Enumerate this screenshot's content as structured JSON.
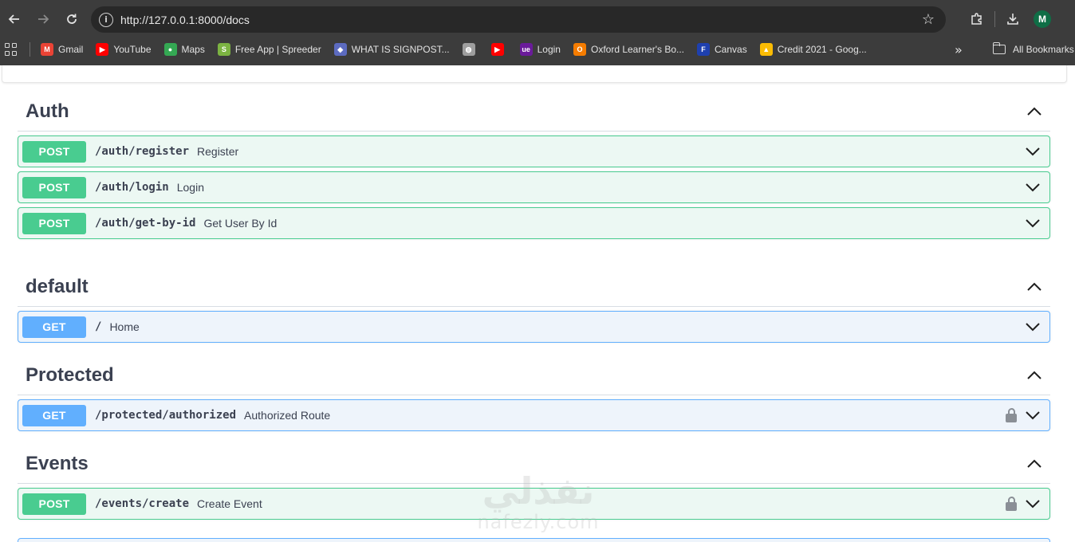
{
  "browser": {
    "url": "http://127.0.0.1:8000/docs",
    "profile_initial": "M",
    "bookmarks": [
      {
        "label": "Gmail",
        "icon": "gmail-icon",
        "color": "#ea4335",
        "glyph": "M"
      },
      {
        "label": "YouTube",
        "icon": "youtube-icon",
        "color": "#ff0000",
        "glyph": "▶"
      },
      {
        "label": "Maps",
        "icon": "maps-icon",
        "color": "#34a853",
        "glyph": "●"
      },
      {
        "label": "Free App | Spreeder",
        "icon": "spreeder-icon",
        "color": "#7cb342",
        "glyph": "S"
      },
      {
        "label": "WHAT IS SIGNPOST...",
        "icon": "signpost-icon",
        "color": "#5c6bc0",
        "glyph": "◆"
      },
      {
        "label": "",
        "icon": "globe-icon",
        "color": "#9e9e9e",
        "glyph": "◍"
      },
      {
        "label": "",
        "icon": "youtube-icon",
        "color": "#ff0000",
        "glyph": "▶"
      },
      {
        "label": "Login",
        "icon": "login-icon",
        "color": "#6a1b9a",
        "glyph": "ue"
      },
      {
        "label": "Oxford Learner's Bo...",
        "icon": "oxford-icon",
        "color": "#f57c00",
        "glyph": "O"
      },
      {
        "label": "Canvas",
        "icon": "canvas-icon",
        "color": "#1e40af",
        "glyph": "F"
      },
      {
        "label": "Credit 2021  - Goog...",
        "icon": "google-drive-icon",
        "color": "#fbbc04",
        "glyph": "▲"
      }
    ],
    "all_bookmarks_label": "All Bookmarks"
  },
  "sections": [
    {
      "title": "Auth",
      "ops": [
        {
          "method": "POST",
          "path": "/auth/register",
          "summary": "Register",
          "locked": false
        },
        {
          "method": "POST",
          "path": "/auth/login",
          "summary": "Login",
          "locked": false
        },
        {
          "method": "POST",
          "path": "/auth/get-by-id",
          "summary": "Get User By Id",
          "locked": false
        }
      ]
    },
    {
      "title": "default",
      "ops": [
        {
          "method": "GET",
          "path": "/",
          "summary": "Home",
          "locked": false
        }
      ]
    },
    {
      "title": "Protected",
      "ops": [
        {
          "method": "GET",
          "path": "/protected/authorized",
          "summary": "Authorized Route",
          "locked": true
        }
      ]
    },
    {
      "title": "Events",
      "ops": [
        {
          "method": "POST",
          "path": "/events/create",
          "summary": "Create Event",
          "locked": true
        }
      ]
    }
  ],
  "watermark": {
    "arabic": "نفذلي",
    "latin": "nafezly.com"
  },
  "colors": {
    "post": "#49cc90",
    "get": "#61affe",
    "text": "#3b4151"
  }
}
